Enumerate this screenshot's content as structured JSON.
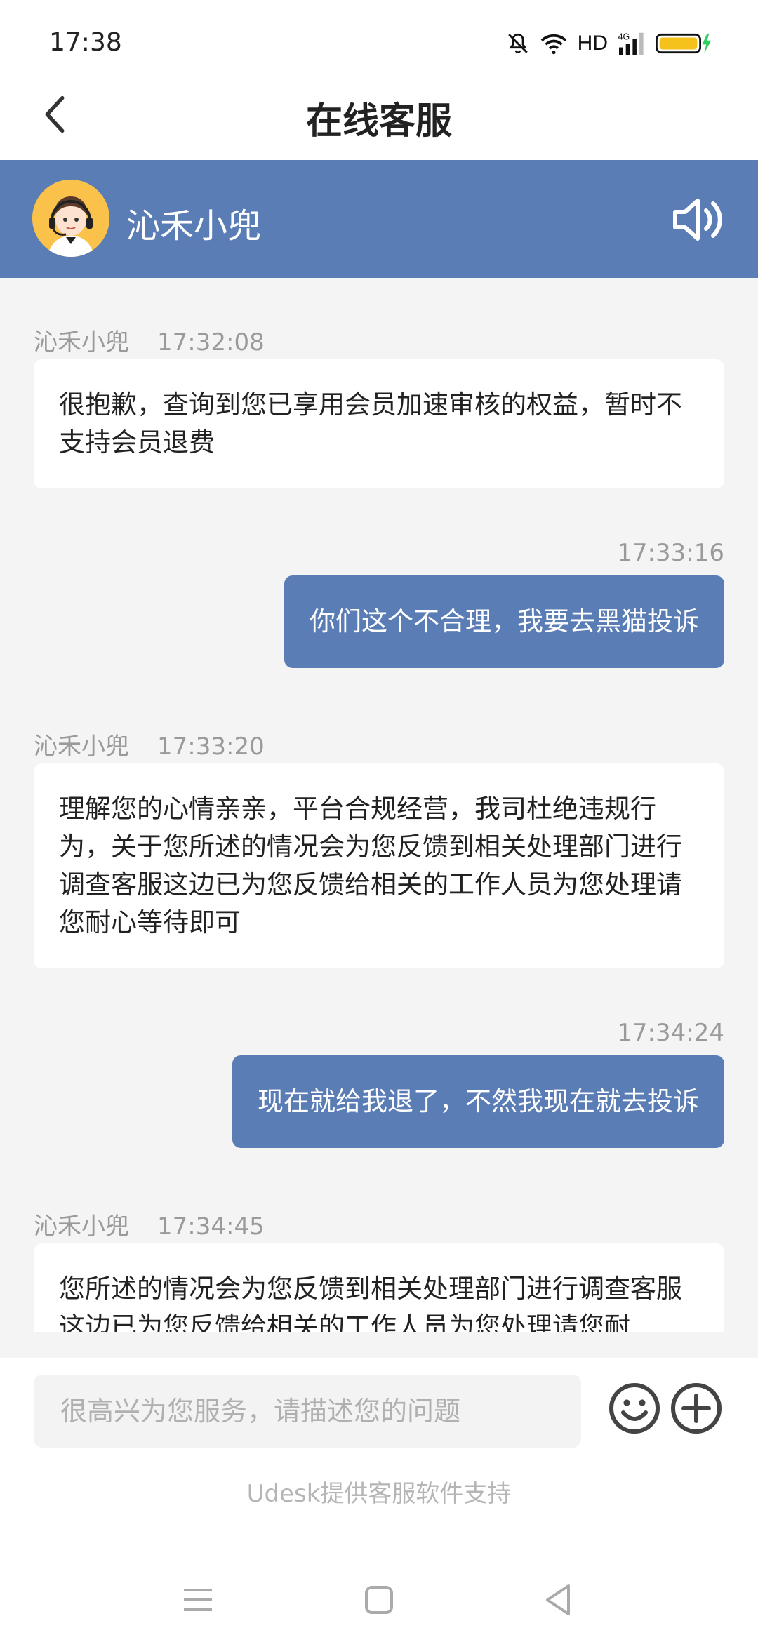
{
  "status_bar": {
    "time": "17:38",
    "hd": "HD",
    "network": "4G",
    "icons": [
      "mute-bell-icon",
      "wifi-icon",
      "signal-icon",
      "battery-charging-icon"
    ]
  },
  "nav": {
    "title": "在线客服",
    "back_icon": "chevron-left-icon"
  },
  "agent": {
    "name": "沁禾小兜",
    "avatar": "customer-service-avatar",
    "speaker_icon": "speaker-icon"
  },
  "messages": [
    {
      "from": "agent",
      "sender": "沁禾小兜",
      "time": "17:32:08",
      "text": "很抱歉，查询到您已享用会员加速审核的权益，暂时不支持会员退费"
    },
    {
      "from": "user",
      "time": "17:33:16",
      "text": "你们这个不合理，我要去黑猫投诉"
    },
    {
      "from": "agent",
      "sender": "沁禾小兜",
      "time": "17:33:20",
      "text": "理解您的心情亲亲，平台合规经营，我司杜绝违规行为，关于您所述的情况会为您反馈到相关处理部门进行调查客服这边已为您反馈给相关的工作人员为您处理请您耐心等待即可"
    },
    {
      "from": "user",
      "time": "17:34:24",
      "text": "现在就给我退了，不然我现在就去投诉"
    },
    {
      "from": "agent",
      "sender": "沁禾小兜",
      "time": "17:34:45",
      "text": "您所述的情况会为您反馈到相关处理部门进行调查客服这边已为您反馈给相关的工作人员为您处理请您耐"
    }
  ],
  "input": {
    "placeholder": "很高兴为您服务，请描述您的问题",
    "value": ""
  },
  "footer": {
    "powered_by": "Udesk提供客服软件支持"
  },
  "colors": {
    "accent": "#5b7db6",
    "background": "#f4f4f4",
    "bubble_agent": "#ffffff"
  }
}
